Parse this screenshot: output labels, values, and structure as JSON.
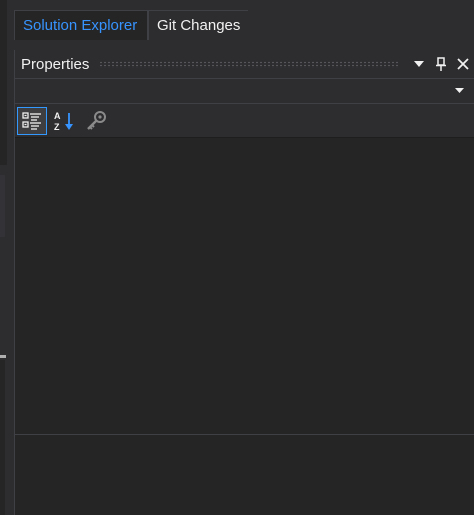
{
  "tabs": [
    {
      "label": "Solution Explorer",
      "active": true
    },
    {
      "label": "Git Changes",
      "active": false
    }
  ],
  "properties_panel": {
    "title": "Properties",
    "header_buttons": [
      "window-position-dropdown-icon",
      "pin-icon",
      "close-icon"
    ],
    "object_selector": {
      "value": ""
    },
    "toolbar": [
      {
        "name": "categorized-icon",
        "checked": true
      },
      {
        "name": "alphabetical-sort-icon",
        "checked": false
      },
      {
        "name": "property-pages-icon",
        "checked": false
      }
    ]
  },
  "colors": {
    "background": "#252526",
    "chrome": "#2d2d30",
    "border": "#3f3f46",
    "accent": "#3794ff",
    "text": "#f1f1f1"
  }
}
